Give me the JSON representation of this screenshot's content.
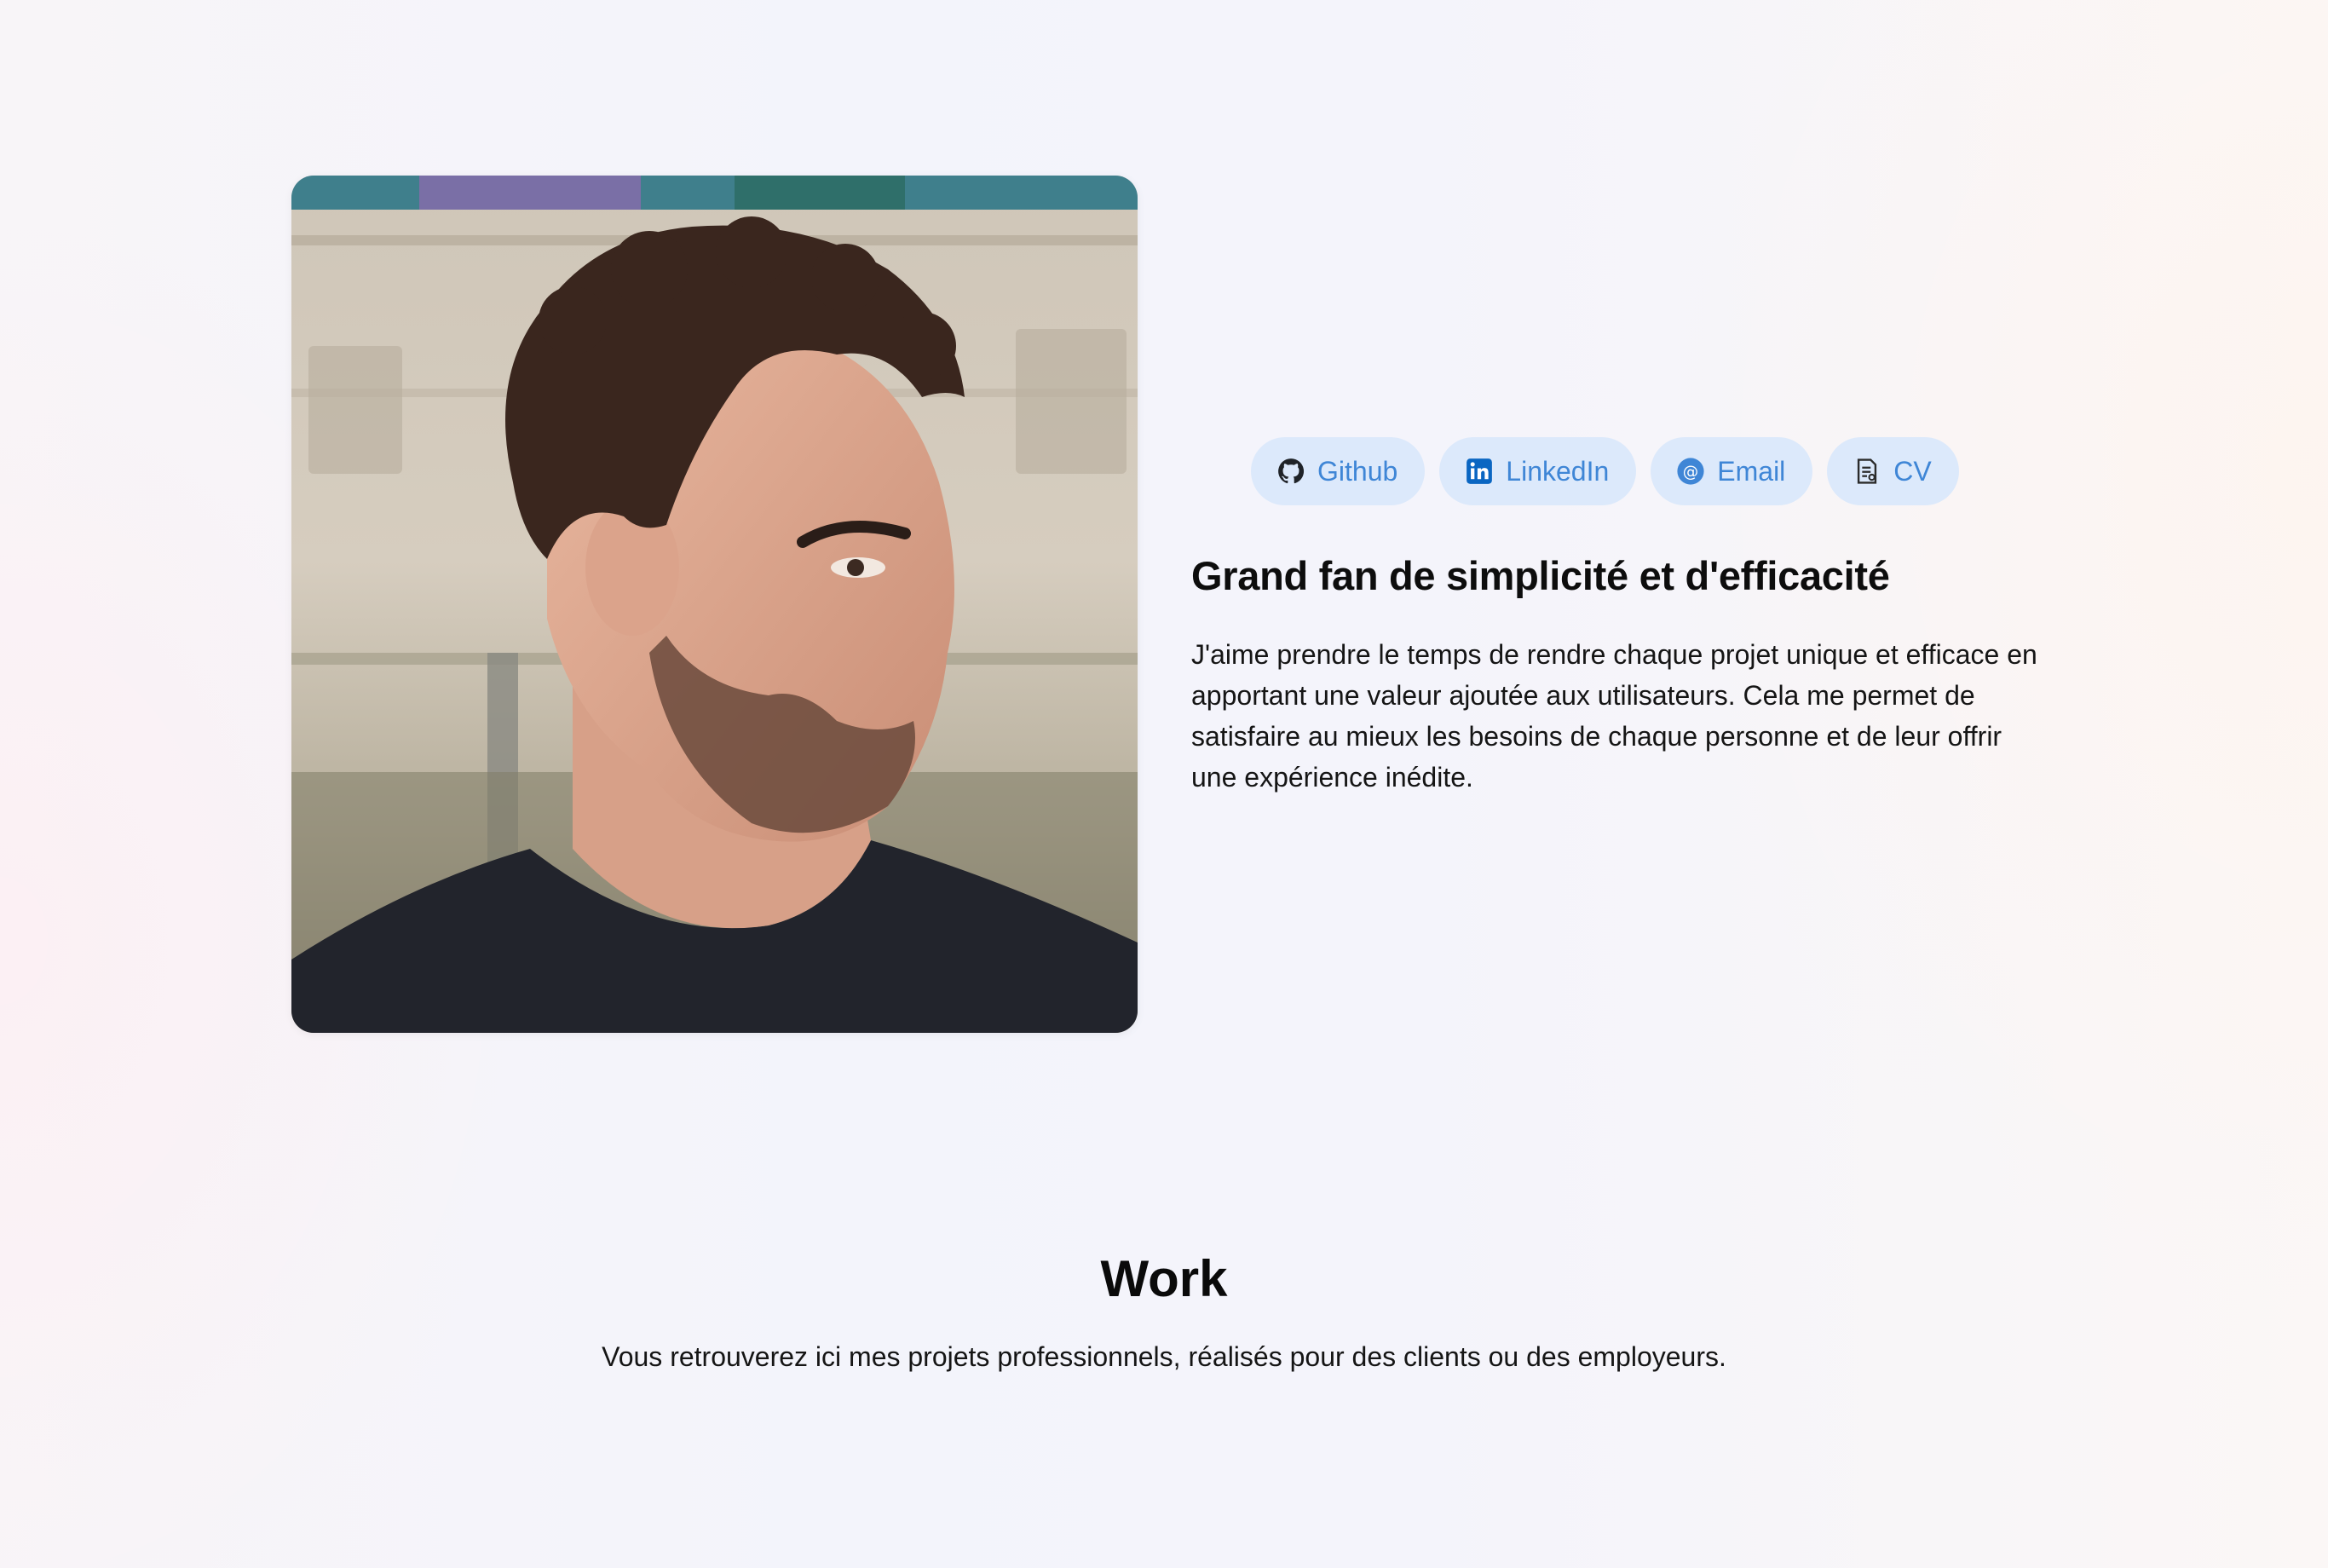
{
  "profile": {
    "photo_alt": "portrait photo"
  },
  "links": [
    {
      "label": "Github",
      "icon": "github-icon"
    },
    {
      "label": "LinkedIn",
      "icon": "linkedin-icon"
    },
    {
      "label": "Email",
      "icon": "at-sign-icon"
    },
    {
      "label": "CV",
      "icon": "document-icon"
    }
  ],
  "hero": {
    "headline": "Grand fan de simplicité et d'efficacité",
    "bio": "J'aime prendre le temps de rendre chaque projet unique et efficace en apportant une valeur ajoutée aux utilisateurs. Cela me permet de satisfaire au mieux les besoins de chaque personne et de leur offrir une expérience inédite."
  },
  "work": {
    "title": "Work",
    "subtitle": "Vous retrouverez ici mes projets professionnels, réalisés pour des clients ou des employeurs."
  },
  "colors": {
    "chip_background": "#dce9fb",
    "chip_text": "#3f86d6",
    "text": "#111111"
  }
}
